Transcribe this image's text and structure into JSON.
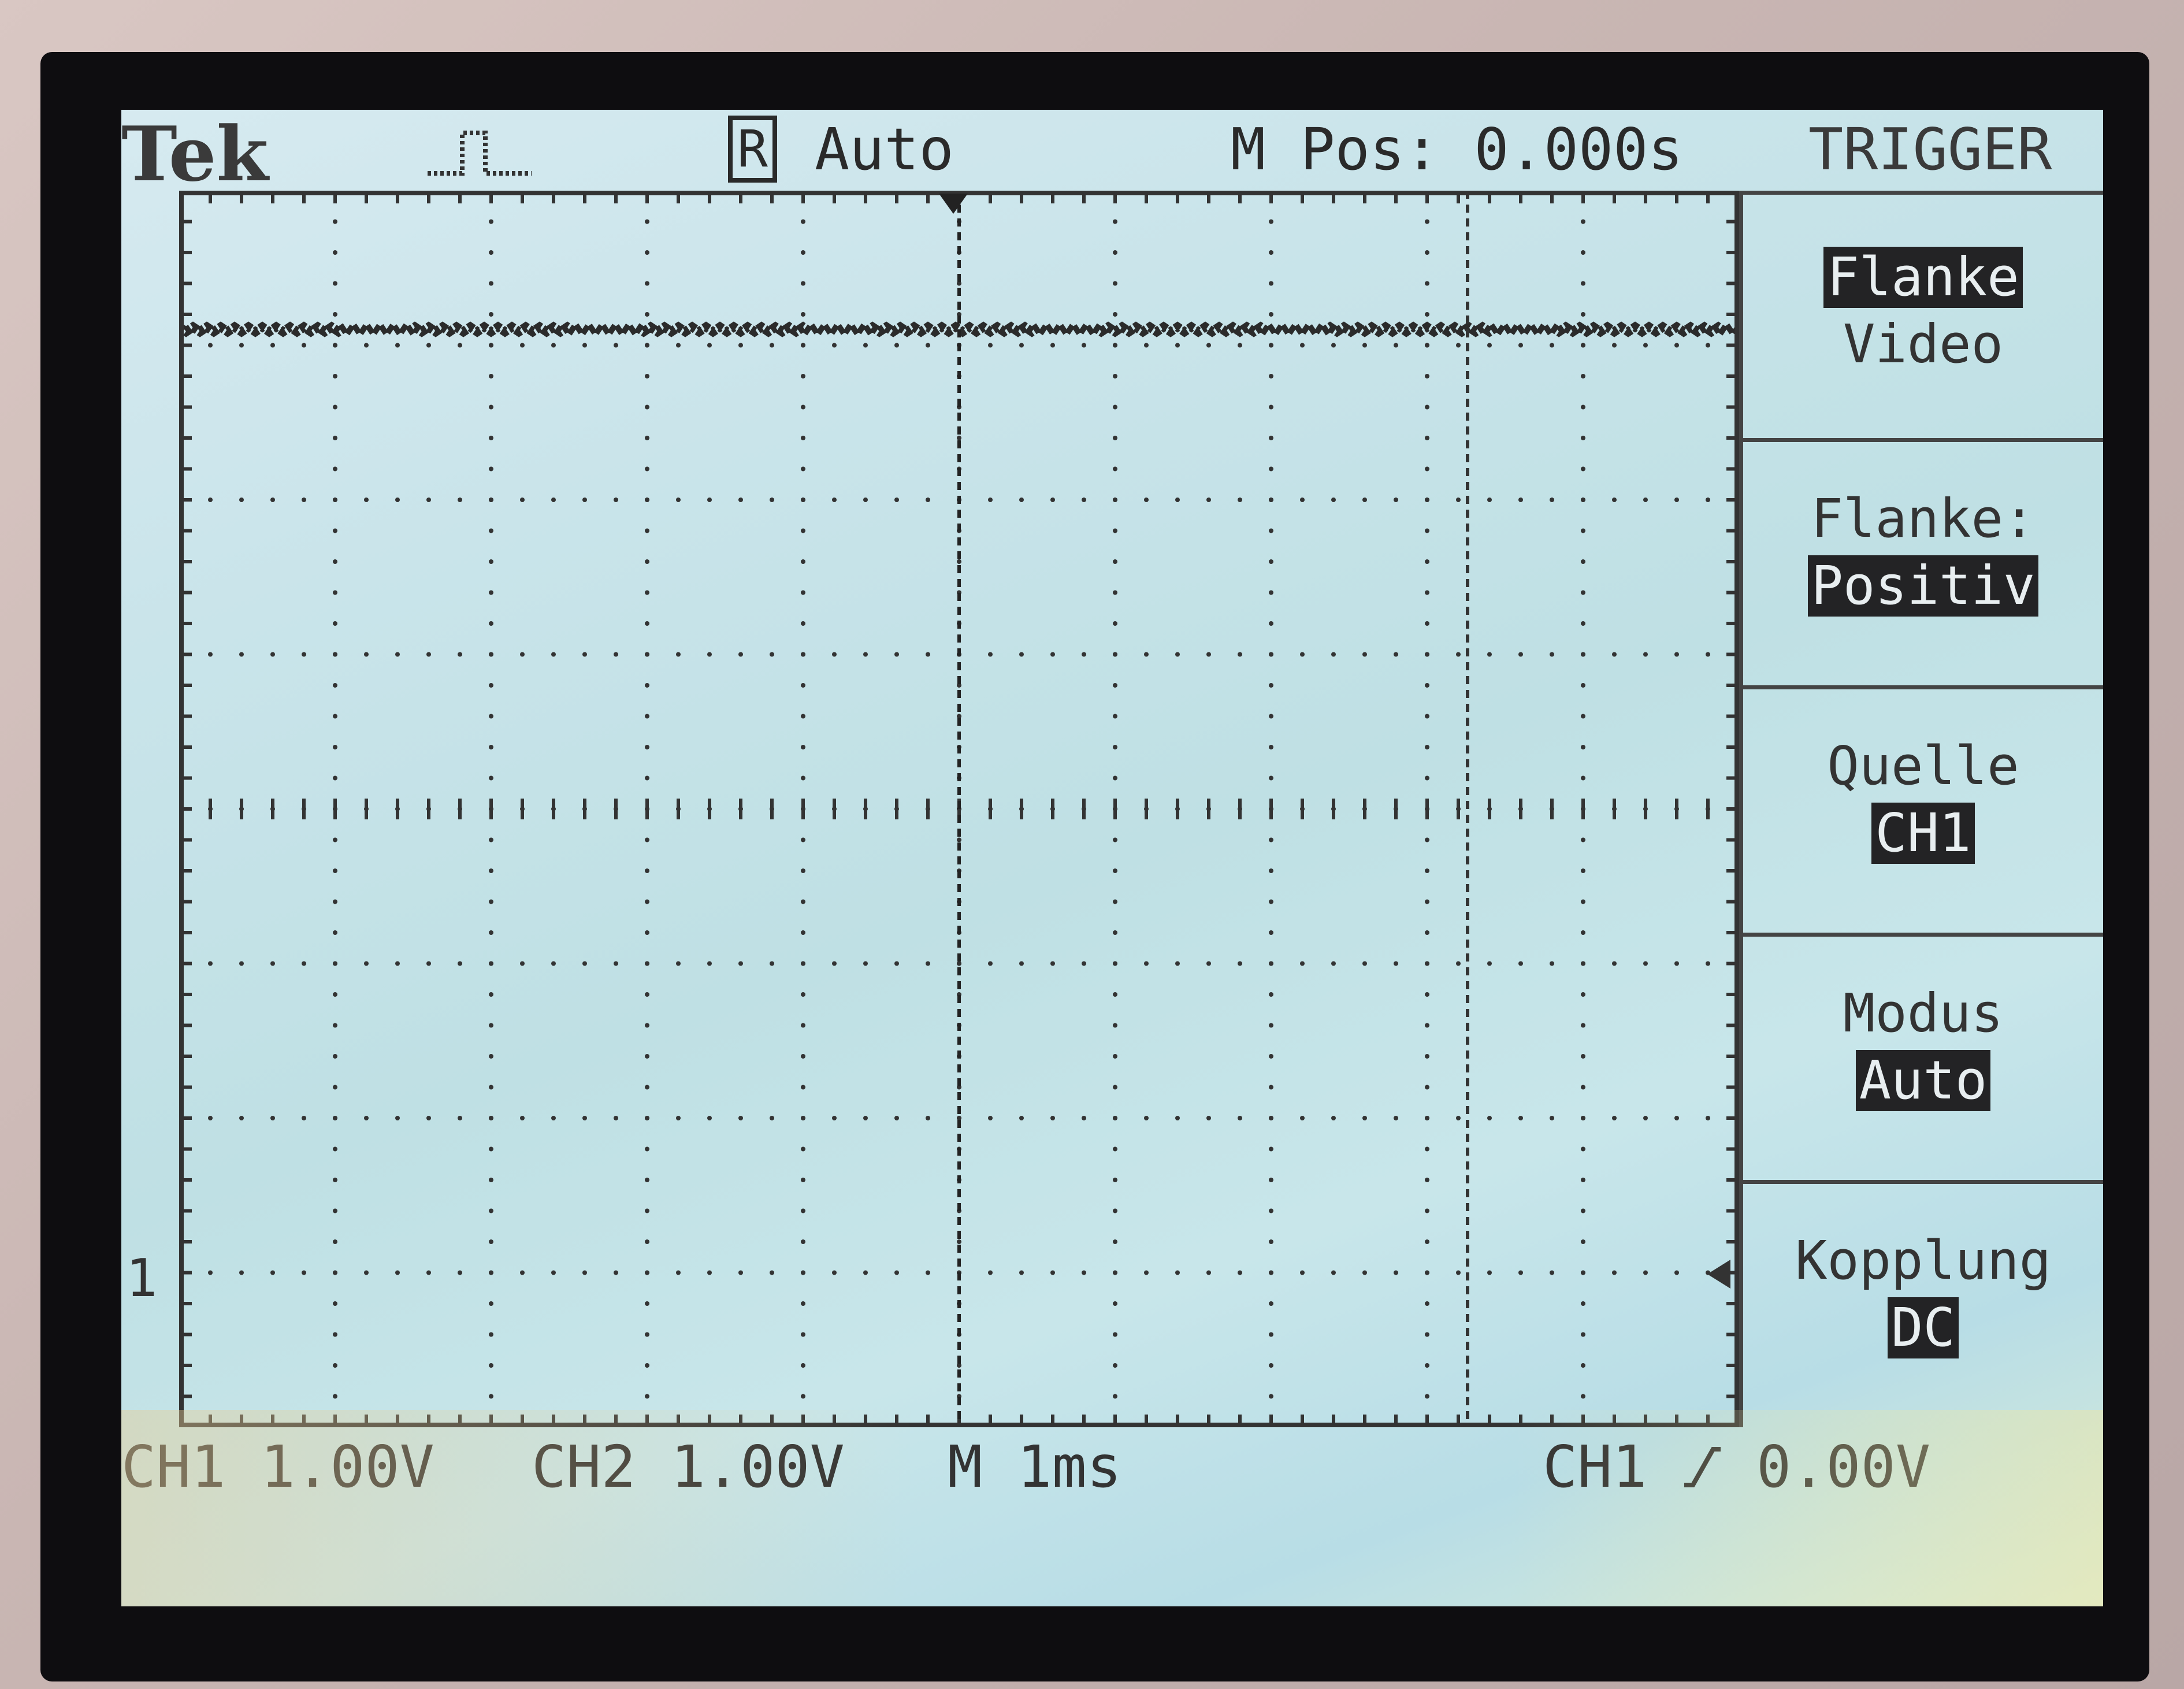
{
  "header": {
    "brand": "Tek",
    "run_mode_icon_letter": "R",
    "run_mode": "Auto",
    "m_pos": "M Pos: 0.000s",
    "menu_title": "TRIGGER",
    "acquisition_icon": "pulse-icon"
  },
  "side_menu": {
    "item1": {
      "top_value": "Flanke",
      "plain": "Video"
    },
    "item2": {
      "label": "Flanke:",
      "value": "Positiv"
    },
    "item3": {
      "label": "Quelle",
      "value": "CH1"
    },
    "item4": {
      "label": "Modus",
      "value": "Auto"
    },
    "item5": {
      "label": "Kopplung",
      "value": "DC"
    }
  },
  "status": {
    "ch1": "CH1 1.00V",
    "ch2": "CH2 1.00V",
    "time": "M 1ms",
    "trigger_source": "CH1",
    "trigger_slope_icon": "rising-edge-icon",
    "trigger_level": "0.00V"
  },
  "markers": {
    "ch1_ground": "1"
  },
  "colors": {
    "lcd_text": "#2a2a2a",
    "highlight_bg": "#232325",
    "screen_bg": "#c9e4ea"
  }
}
